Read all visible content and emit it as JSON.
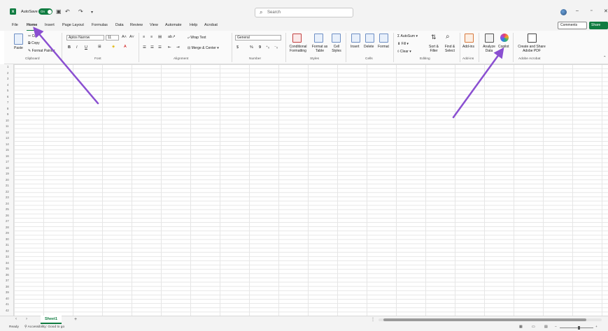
{
  "titlebar": {
    "autosave_label": "AutoSave",
    "autosave_state": "On",
    "search_placeholder": "Search"
  },
  "menu": {
    "tabs": [
      "File",
      "Home",
      "Insert",
      "Page Layout",
      "Formulas",
      "Data",
      "Review",
      "View",
      "Automate",
      "Help",
      "Acrobat"
    ],
    "active_tab": "Home",
    "comments_label": "Comments",
    "share_label": "Share"
  },
  "ribbon": {
    "clipboard": {
      "paste": "Paste",
      "cut": "Cut",
      "copy": "Copy",
      "format_painter": "Format Painter",
      "group_label": "Clipboard"
    },
    "font": {
      "font_name": "Aptos Narrow",
      "font_size": "11",
      "bold": "B",
      "italic": "I",
      "underline": "U",
      "group_label": "Font"
    },
    "alignment": {
      "wrap_text": "Wrap Text",
      "merge_center": "Merge & Center",
      "group_label": "Alignment"
    },
    "number": {
      "format": "General",
      "currency": "$",
      "percent": "%",
      "comma": "9",
      "group_label": "Number"
    },
    "styles": {
      "conditional": "Conditional Formatting",
      "format_table": "Format as Table",
      "cell_styles": "Cell Styles",
      "group_label": "Styles"
    },
    "cells": {
      "insert": "Insert",
      "delete": "Delete",
      "format": "Format",
      "group_label": "Cells"
    },
    "editing": {
      "autosum": "AutoSum",
      "fill": "Fill",
      "clear": "Clear",
      "sort_filter": "Sort & Filter",
      "find_select": "Find & Select",
      "group_label": "Editing"
    },
    "addins": {
      "addins": "Add-ins",
      "group_label": "Add-ins"
    },
    "analyze": {
      "analyze_data": "Analyze Data",
      "copilot": "Copilot"
    },
    "acrobat": {
      "create_share": "Create and Share Adobe PDF",
      "group_label": "Adobe Acrobat"
    }
  },
  "grid": {
    "row_numbers": [
      "1",
      "2",
      "3",
      "4",
      "5",
      "6",
      "7",
      "8",
      "9",
      "10",
      "11",
      "12",
      "13",
      "14",
      "15",
      "16",
      "17",
      "18",
      "19",
      "20",
      "21",
      "22",
      "23",
      "24",
      "25",
      "26",
      "27",
      "28",
      "29",
      "30",
      "31",
      "32",
      "33",
      "34",
      "35",
      "36",
      "37",
      "38",
      "39",
      "40",
      "41",
      "42"
    ]
  },
  "sheetbar": {
    "sheet_name": "Sheet1"
  },
  "status": {
    "ready": "Ready",
    "accessibility": "Accessibility: Good to go"
  },
  "colors": {
    "brand_green": "#107c41",
    "arrow_purple": "#8a4fd1"
  }
}
